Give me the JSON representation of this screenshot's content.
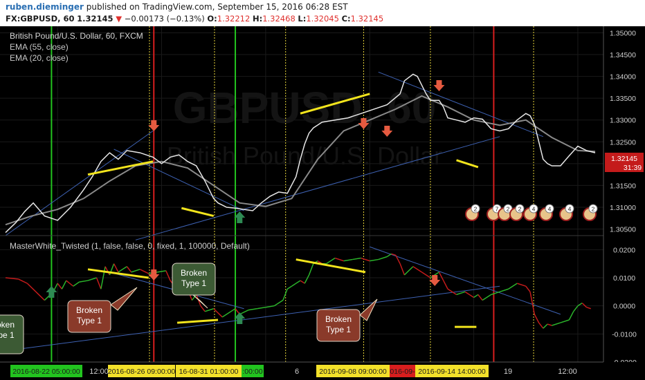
{
  "header": {
    "author": "ruben.dieminger",
    "published_text": "published on TradingView.com, September 15, 2016 06:28 EST",
    "symbol": "FX:GBPUSD, 60",
    "last": "1.32145",
    "change_arrow": "▼",
    "change": "−0.00173 (−0.13%)",
    "o_label": "O:",
    "o_value": "1.32212",
    "h_label": "H:",
    "h_value": "1.32468",
    "l_label": "L:",
    "l_value": "1.32045",
    "c_label": "C:",
    "c_value": "1.32145"
  },
  "colors": {
    "background": "#000000",
    "grid": "#1a1a1a",
    "ema_fast": "#e8e8e8",
    "ema_slow": "#8a8a8a",
    "trend_line": "#3e62b4",
    "highlight": "#f2e41c",
    "green_line": "#22c41f",
    "red_line": "#d81e1e",
    "yellow_dotted": "#e8d63a",
    "down_arrow": "#e55a40",
    "up_arrow": "#2e8a53",
    "price_label": "#c41b1b",
    "osc_up": "#2bb52b",
    "osc_down": "#c41b1b",
    "callout_red": "#8a3a2a",
    "callout_green": "#3c5a34"
  },
  "watermark": {
    "symbol": "GBPUSD, 60",
    "name": "British Pound/U.S. Dollar"
  },
  "legend": {
    "title": "British Pound/U.S. Dollar, 60, FXCM",
    "ema55": "EMA (55, close)",
    "ema20": "EMA (20, close)",
    "oscillator": "MasterWhite_Twisted (1, false, false, 0, fixed, 1, 100000, Default)"
  },
  "price_label": {
    "value": "1.32145",
    "countdown": "31:39"
  },
  "chart_data": [
    {
      "type": "line",
      "title": "British Pound/U.S. Dollar, 60, FXCM",
      "ylim": [
        1.3035,
        1.3515
      ],
      "y_ticks": [
        "1.35000",
        "1.34500",
        "1.34000",
        "1.33500",
        "1.33000",
        "1.32500",
        "1.32000",
        "1.31500",
        "1.31000",
        "1.30500"
      ],
      "series": [
        {
          "name": "EMA (20, close)",
          "x": [
            0,
            12,
            22,
            32,
            45,
            60,
            75,
            90,
            100,
            110,
            120,
            130,
            140,
            155,
            170,
            180,
            190,
            200,
            210,
            220,
            230,
            240,
            245,
            250,
            255,
            265,
            275,
            285,
            295,
            305,
            315,
            325,
            335,
            340,
            345,
            350,
            355,
            365,
            380,
            395,
            410,
            425,
            440,
            455,
            460,
            470,
            475,
            480,
            485,
            490,
            495,
            500,
            505,
            510,
            520,
            530,
            540,
            550,
            560,
            570,
            580,
            590,
            600,
            605,
            610,
            615,
            620,
            625,
            630,
            640,
            650,
            660,
            670,
            680
          ],
          "values": [
            1.3042,
            1.3065,
            1.309,
            1.311,
            1.308,
            1.307,
            1.31,
            1.314,
            1.317,
            1.3205,
            1.3225,
            1.321,
            1.323,
            1.3225,
            1.3215,
            1.32,
            1.3215,
            1.322,
            1.3205,
            1.3195,
            1.316,
            1.312,
            1.311,
            1.3105,
            1.31,
            1.3098,
            1.3095,
            1.3092,
            1.311,
            1.3125,
            1.3135,
            1.3132,
            1.317,
            1.321,
            1.3245,
            1.327,
            1.3282,
            1.3295,
            1.33,
            1.3305,
            1.3315,
            1.3325,
            1.3335,
            1.336,
            1.339,
            1.3405,
            1.34,
            1.338,
            1.336,
            1.3345,
            1.3345,
            1.3345,
            1.333,
            1.3305,
            1.33,
            1.3295,
            1.3305,
            1.3302,
            1.328,
            1.3275,
            1.328,
            1.33,
            1.3315,
            1.331,
            1.329,
            1.325,
            1.321,
            1.32,
            1.3195,
            1.3195,
            1.3218,
            1.324,
            1.323,
            1.3225
          ]
        },
        {
          "name": "EMA (55, close)",
          "x": [
            0,
            30,
            60,
            90,
            120,
            150,
            180,
            210,
            240,
            270,
            300,
            330,
            360,
            390,
            420,
            450,
            480,
            510,
            540,
            570,
            600,
            630,
            660,
            680
          ],
          "values": [
            1.306,
            1.308,
            1.3095,
            1.312,
            1.316,
            1.3195,
            1.3205,
            1.319,
            1.315,
            1.311,
            1.3102,
            1.312,
            1.321,
            1.3275,
            1.33,
            1.3325,
            1.3355,
            1.333,
            1.33,
            1.3288,
            1.33,
            1.326,
            1.323,
            1.3228
          ]
        }
      ]
    },
    {
      "type": "line",
      "title": "MasterWhite_Twisted (1, false, false, 0, fixed, 1, 100000, Default)",
      "ylim": [
        -0.02,
        0.025
      ],
      "y_ticks": [
        "0.0200",
        "0.0100",
        "0.0000",
        "-0.0100",
        "-0.0200"
      ],
      "series": [
        {
          "name": "MasterWhite_Twisted",
          "x": [
            0,
            15,
            25,
            35,
            45,
            55,
            60,
            65,
            70,
            78,
            85,
            95,
            105,
            110,
            115,
            120,
            125,
            130,
            135,
            140,
            145,
            155,
            165,
            175,
            185,
            190,
            195,
            200,
            205,
            210,
            215,
            220,
            225,
            230,
            240,
            250,
            260,
            265,
            270,
            280,
            290,
            300,
            310,
            320,
            325,
            330,
            335,
            340,
            345,
            350,
            355,
            360,
            365,
            370,
            380,
            390,
            400,
            410,
            420,
            430,
            440,
            445,
            450,
            455,
            460,
            470,
            480,
            490,
            495,
            500,
            505,
            510,
            520,
            530,
            540,
            545,
            550,
            560,
            570,
            580,
            590,
            600,
            605,
            610,
            615,
            620,
            625,
            630,
            640,
            650,
            655,
            660,
            665,
            670,
            675
          ],
          "values": [
            0.01,
            0.0095,
            0.008,
            0.005,
            0.002,
            0.005,
            0.008,
            0.006,
            0.009,
            0.007,
            0.0085,
            0.009,
            0.01,
            0.006,
            0.014,
            0.011,
            0.015,
            0.012,
            0.013,
            0.014,
            0.012,
            0.013,
            0.0115,
            0.012,
            0.0125,
            0.009,
            0.007,
            0.005,
            0.011,
            0.006,
            0.002,
            0.004,
            0.0,
            -0.002,
            -0.001,
            -0.004,
            -0.002,
            -0.001,
            -0.003,
            -0.0015,
            -0.001,
            -0.0005,
            0.0,
            0.002,
            0.006,
            0.007,
            0.008,
            0.009,
            0.008,
            0.011,
            0.015,
            0.016,
            0.015,
            0.015,
            0.017,
            0.016,
            0.0165,
            0.017,
            0.016,
            0.0165,
            0.0175,
            0.0185,
            0.018,
            0.015,
            0.011,
            0.014,
            0.012,
            0.01,
            0.011,
            0.012,
            0.009,
            0.006,
            0.004,
            0.005,
            0.003,
            0.004,
            0.002,
            0.004,
            0.005,
            0.006,
            0.008,
            0.007,
            0.005,
            -0.003,
            -0.006,
            -0.008,
            -0.0065,
            -0.007,
            -0.006,
            -0.005,
            -0.002,
            0.0,
            0.001,
            -0.0005,
            -0.001
          ]
        }
      ]
    }
  ],
  "time_axis": {
    "plain_ticks": [
      "12:00",
      "6",
      "19",
      "12:00"
    ],
    "highlighted": [
      {
        "label": "2016-08-22 05:00:00",
        "color": "#22c41f"
      },
      {
        "label": "2016-08-26 09:00:00",
        "color": "#f3e12a"
      },
      {
        "label": "16-08-31 01:00:00",
        "color": "#f3e12a"
      },
      {
        "label": ":00:00",
        "color": "#22c41f"
      },
      {
        "label": "2016-09-08 09:00:00",
        "color": "#f3e12a"
      },
      {
        "label": "016-09-",
        "color": "#d81e1e"
      },
      {
        "label": "2016-09-14 14:00:00",
        "color": "#f3e12a"
      }
    ]
  },
  "callouts": [
    {
      "lines": [
        "roken",
        "ype 1"
      ],
      "color": "#3c5a34"
    },
    {
      "lines": [
        "Broken",
        "Type 1"
      ],
      "color": "#8a3a2a"
    },
    {
      "lines": [
        "Broken",
        "Type 1"
      ],
      "color": "#3c5a34"
    },
    {
      "lines": [
        "Broken",
        "Type 1"
      ],
      "color": "#8a3a2a"
    }
  ],
  "events": [
    {
      "badge": "2"
    },
    {
      "badge": "7"
    },
    {
      "badge": "2"
    },
    {
      "badge": "2"
    },
    {
      "badge": "4"
    },
    {
      "badge": "4"
    },
    {
      "badge": "4"
    },
    {
      "badge": "2"
    }
  ]
}
